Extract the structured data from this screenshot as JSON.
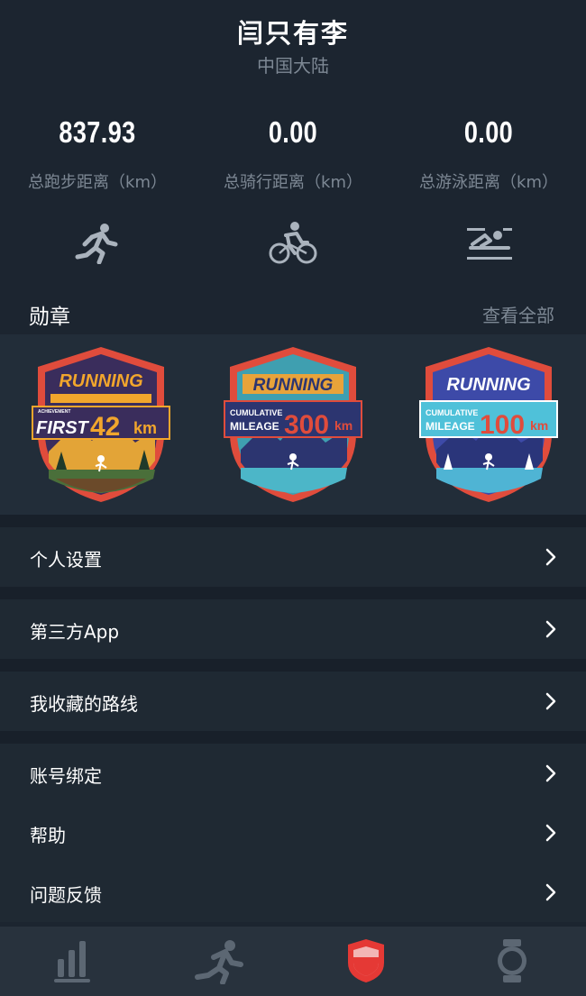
{
  "profile": {
    "name": "闫只有李",
    "region": "中国大陆"
  },
  "stats": [
    {
      "value": "837.93",
      "label": "总跑步距离（km）",
      "icon": "running-icon"
    },
    {
      "value": "0.00",
      "label": "总骑行距离（km）",
      "icon": "cycling-icon"
    },
    {
      "value": "0.00",
      "label": "总游泳距离（km）",
      "icon": "swimming-icon"
    }
  ],
  "medals": {
    "title": "勋章",
    "view_all": "查看全部",
    "items": [
      {
        "top": "RUNNING",
        "small": "ACHIEVEMENT",
        "line1": "FIRST",
        "big": "42",
        "unit": "km"
      },
      {
        "top": "RUNNING",
        "small": "CUMULATIVE",
        "line1": "MILEAGE",
        "big": "300",
        "unit": "km"
      },
      {
        "top": "RUNNING",
        "small": "CUMULATIVE",
        "line1": "MILEAGE",
        "big": "100",
        "unit": "km"
      }
    ]
  },
  "menu": {
    "personal_settings": "个人设置",
    "third_party_app": "第三方App",
    "saved_routes": "我收藏的路线",
    "account_binding": "账号绑定",
    "help": "帮助",
    "feedback": "问题反馈"
  },
  "tabbar": {
    "tabs": [
      "stats-icon",
      "running-icon",
      "shield-icon",
      "watch-icon"
    ],
    "active_color": "#e53935",
    "inactive_color": "#5c6773"
  }
}
